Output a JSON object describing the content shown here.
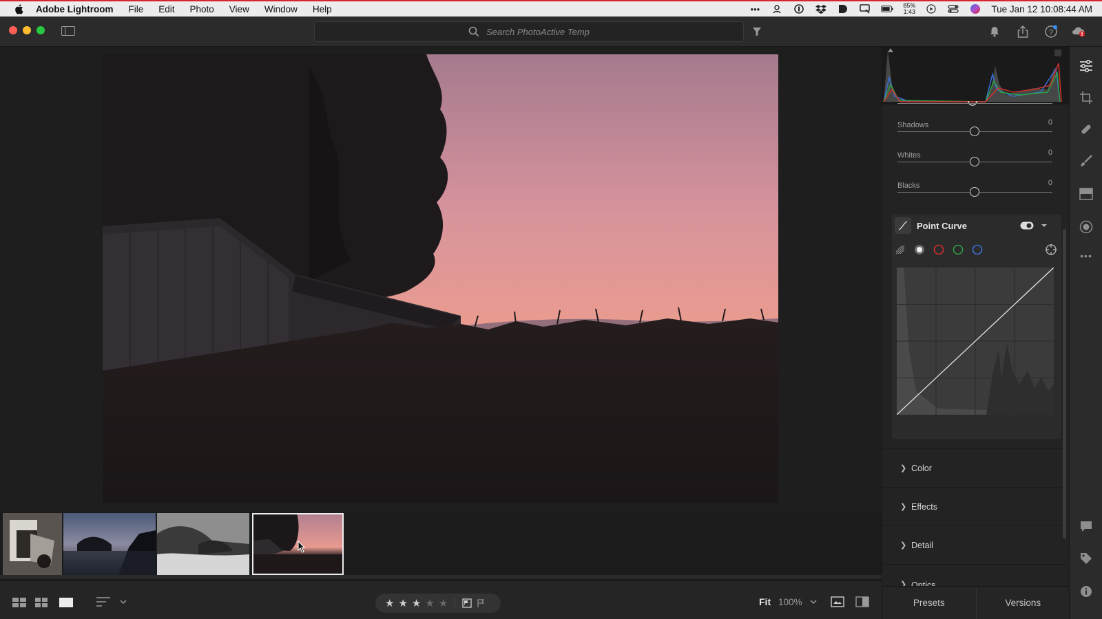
{
  "menubar": {
    "app_name": "Adobe Lightroom",
    "items": [
      "File",
      "Edit",
      "Photo",
      "View",
      "Window",
      "Help"
    ],
    "battery_percent": "85%",
    "battery_time": "1:43",
    "datetime": "Tue Jan 12  10:08:44 AM"
  },
  "toolbar": {
    "search_placeholder": "Search PhotoActive Temp"
  },
  "filmstrip": {
    "thumbnails": [
      "thumb-1",
      "thumb-2",
      "thumb-3",
      "thumb-4"
    ],
    "selected_index": 3
  },
  "bottombar": {
    "rating_stars_filled": 3,
    "rating_stars_total": 5,
    "fit_label": "Fit",
    "zoom_label": "100%"
  },
  "edit_panel": {
    "sliders": [
      {
        "label": "Shadows",
        "value": "0",
        "position": 0.5
      },
      {
        "label": "Whites",
        "value": "0",
        "position": 0.5
      },
      {
        "label": "Blacks",
        "value": "0",
        "position": 0.5
      }
    ],
    "curve_title": "Point Curve",
    "sections": [
      "Color",
      "Effects",
      "Detail",
      "Optics"
    ],
    "tabs": {
      "presets": "Presets",
      "versions": "Versions"
    }
  },
  "colors": {
    "accent_red": "#d9232d",
    "channel_red": "#d0312d",
    "channel_green": "#2ea043",
    "channel_blue": "#3b6fd6"
  }
}
